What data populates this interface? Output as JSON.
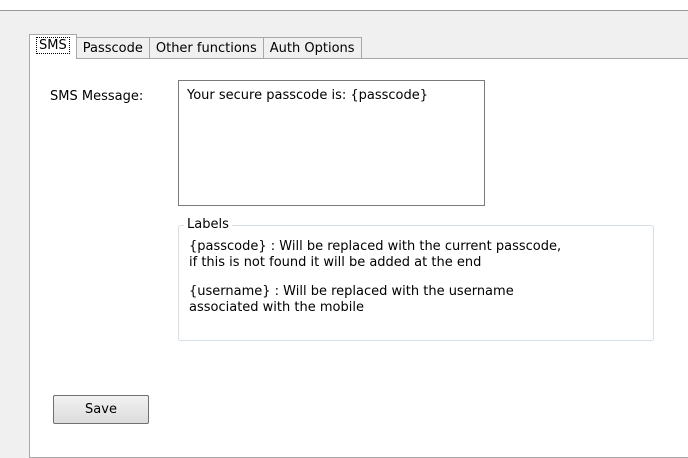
{
  "tabs": [
    {
      "label": "SMS",
      "active": true
    },
    {
      "label": "Passcode",
      "active": false
    },
    {
      "label": "Other functions",
      "active": false
    },
    {
      "label": "Auth Options",
      "active": false
    }
  ],
  "sms": {
    "label": "SMS Message:",
    "message": "Your secure passcode is: {passcode}"
  },
  "labels_group": {
    "title": "Labels",
    "items": [
      "{passcode} : Will be replaced with the current passcode,\nif this is not found it will be added at the end",
      "{username} : Will be replaced with the username\nassociated with the mobile"
    ]
  },
  "actions": {
    "save_label": "Save"
  }
}
